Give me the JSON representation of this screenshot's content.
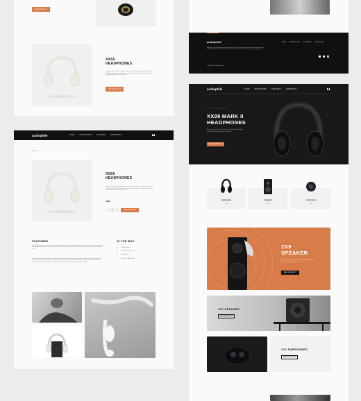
{
  "brand": "audiophile",
  "nav": [
    "HOME",
    "HEADPHONES",
    "SPEAKERS",
    "EARPHONES"
  ],
  "colors": {
    "accent": "#d87d4a",
    "dark": "#101010",
    "light": "#f1f1f1"
  },
  "left_top": {
    "see_product": "SEE PRODUCT",
    "product_title_1": "XX59",
    "product_title_2": "HEADPHONES",
    "product_desc": "Enjoy your audio almost anywhere and customize it to your specific tastes with the XX59 headphones. The stylish yet durable versatile wireless headset is a brilliant companion at home or on the move.",
    "product_button": "SEE PRODUCT"
  },
  "left_detail": {
    "go_back": "Go Back",
    "title_1": "XX59",
    "title_2": "HEADPHONES",
    "desc": "Enjoy your audio almost anywhere and customize it to your specific tastes with the XX59 headphones. The stylish yet durable versatile wireless headset is a brilliant companion at home or on the move.",
    "price": "$ 899",
    "qty_minus": "-",
    "qty_value": "1",
    "qty_plus": "+",
    "add_to_cart": "ADD TO CART",
    "features_title": "FEATURES",
    "features_p1": "These headphones have been created from durable, high-quality materials tough enough to take anywhere. Its compact folding design fuses comfort and minimalist style making it perfect for travel. Flawless transmission is assured by the latest wireless technology engineered for audio synchronization with videos.",
    "features_p2": "More than a simple pair of headphones, this headset features a pair of built-in microphones for clear, hands-free calling when paired with a compatible smartphone. Controlling music and calls is also intuitive thanks to easy-access touch buttons on the earcups. Regardless of how you use the XX59 headphones, you can do so all day thanks to an impressive 30-hour battery life that can be rapidly recharged via USB-C.",
    "in_the_box_title": "IN THE BOX",
    "box_items": [
      {
        "qty": "1x",
        "name": "Headphone Unit"
      },
      {
        "qty": "2x",
        "name": "Replacement Earcups"
      },
      {
        "qty": "1x",
        "name": "User Manual"
      },
      {
        "qty": "1x",
        "name": "3.5mm 5m Audio Cable"
      }
    ]
  },
  "right_footer": {
    "desc": "Audiophile is an all in one stop to fulfill your audio needs. We're a small team of music lovers and sound specialists who are devoted to helping you get the most out of personal audio. Come and visit our demo facility - we're open 7 days a week.",
    "copyright": "Copyright 2021. All Rights Reserved",
    "social": [
      "facebook",
      "twitter",
      "instagram"
    ]
  },
  "right_home": {
    "hero_overline": "NEW PRODUCT",
    "hero_title_1": "XX99 MARK II",
    "hero_title_2": "HEADPHONES",
    "hero_desc": "Experience natural, lifelike audio and exceptional build quality made for the passionate music enthusiast.",
    "hero_button": "SEE PRODUCT",
    "categories": [
      {
        "name": "HEADPHONES",
        "shop": "SHOP"
      },
      {
        "name": "SPEAKERS",
        "shop": "SHOP"
      },
      {
        "name": "EARPHONES",
        "shop": "SHOP"
      }
    ],
    "zx9_title_1": "ZX9",
    "zx9_title_2": "SPEAKER",
    "zx9_desc": "Upgrade to premium speakers that are phenomenally built to deliver truly remarkable sound.",
    "zx9_button": "SEE PRODUCT",
    "zx7_title": "ZX7 SPEAKER",
    "zx7_button": "SEE PRODUCT",
    "yx1_title": "YX1 EARPHONES",
    "yx1_button": "SEE PRODUCT"
  }
}
